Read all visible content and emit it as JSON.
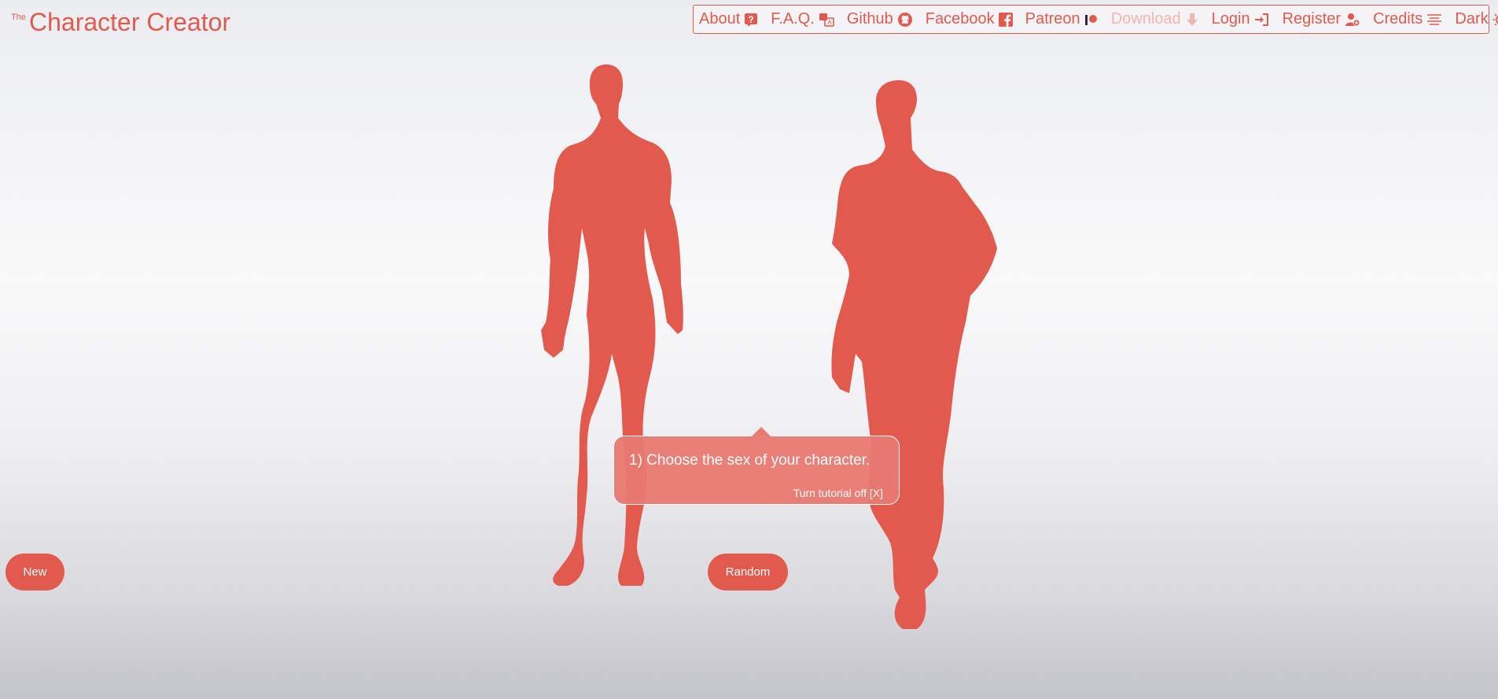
{
  "logo": {
    "prefix": "The",
    "title": "Character Creator"
  },
  "menu": {
    "about": "About",
    "faq": "F.A.Q.",
    "github": "Github",
    "facebook": "Facebook",
    "patreon": "Patreon",
    "download": "Download",
    "login": "Login",
    "register": "Register",
    "credits": "Credits",
    "dark": "Dark"
  },
  "tutorial": {
    "message": "1) Choose the sex of your character.",
    "dismiss": "Turn tutorial off [X]"
  },
  "buttons": {
    "new": "New",
    "random": "Random"
  },
  "colors": {
    "accent": "#e15a4d",
    "disabled": "#f3b5ae"
  },
  "figures": [
    "male-silhouette",
    "female-silhouette"
  ]
}
